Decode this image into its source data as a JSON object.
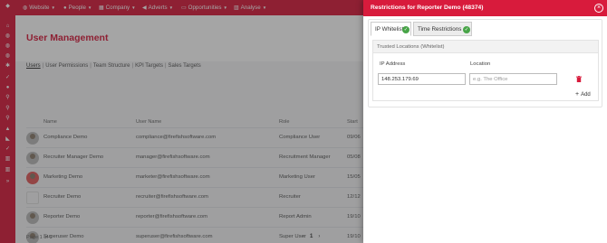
{
  "topbar": {
    "menus": [
      {
        "icon": "globe-icon",
        "glyph": "◍",
        "label": "Website"
      },
      {
        "icon": "user-icon",
        "glyph": "●",
        "label": "People"
      },
      {
        "icon": "building-icon",
        "glyph": "▦",
        "label": "Company"
      },
      {
        "icon": "megaphone-icon",
        "glyph": "◀",
        "label": "Adverts"
      },
      {
        "icon": "briefcase-icon",
        "glyph": "▭",
        "label": "Opportunities"
      },
      {
        "icon": "chart-icon",
        "glyph": "▥",
        "label": "Analyse"
      }
    ]
  },
  "page": {
    "title": "User Management",
    "subnav": [
      "Users",
      "User Permissions",
      "Team Structure",
      "KPI Targets",
      "Sales Targets"
    ]
  },
  "table": {
    "headers": {
      "name": "Name",
      "username": "User Name",
      "role": "Role",
      "start": "Start"
    },
    "rows": [
      {
        "name": "Compliance Demo",
        "username": "compliance@firefishsoftware.com",
        "role": "Compliance User",
        "start": "09/06"
      },
      {
        "name": "Recruiter Manager Demo",
        "username": "manager@firefishsoftware.com",
        "role": "Recruitment Manager",
        "start": "05/08"
      },
      {
        "name": "Marketing Demo",
        "username": "marketer@firefishsoftware.com",
        "role": "Marketing User",
        "start": "15/05"
      },
      {
        "name": "Recruiter Demo",
        "username": "recruiter@firefishsoftware.com",
        "role": "Recruiter",
        "start": "12/12"
      },
      {
        "name": "Reporter Demo",
        "username": "reporter@firefishsoftware.com",
        "role": "Report Admin",
        "start": "19/10"
      },
      {
        "name": "Superuser Demo",
        "username": "superuser@firefishsoftware.com",
        "role": "Super User",
        "start": "19/10"
      }
    ],
    "pager": {
      "label": "Page 1 of 1",
      "prev": "‹",
      "current": "1",
      "next": "›"
    }
  },
  "panel": {
    "title": "Restrictions for Reporter Demo (48374)",
    "close": "×",
    "tabs": [
      {
        "label": "IP Whitelist",
        "check": "✓"
      },
      {
        "label": "Time Restrictions",
        "check": "✓"
      }
    ],
    "trusted": {
      "title": "Trusted Locations (Whitelist)",
      "col_ip": "IP Address",
      "col_location": "Location",
      "ip_value": "148.253.179.69",
      "location_placeholder": "e.g. The Office",
      "add_label": "Add",
      "add_glyph": "+"
    }
  },
  "colors": {
    "brand": "#d81b3c",
    "check": "#47a447"
  }
}
